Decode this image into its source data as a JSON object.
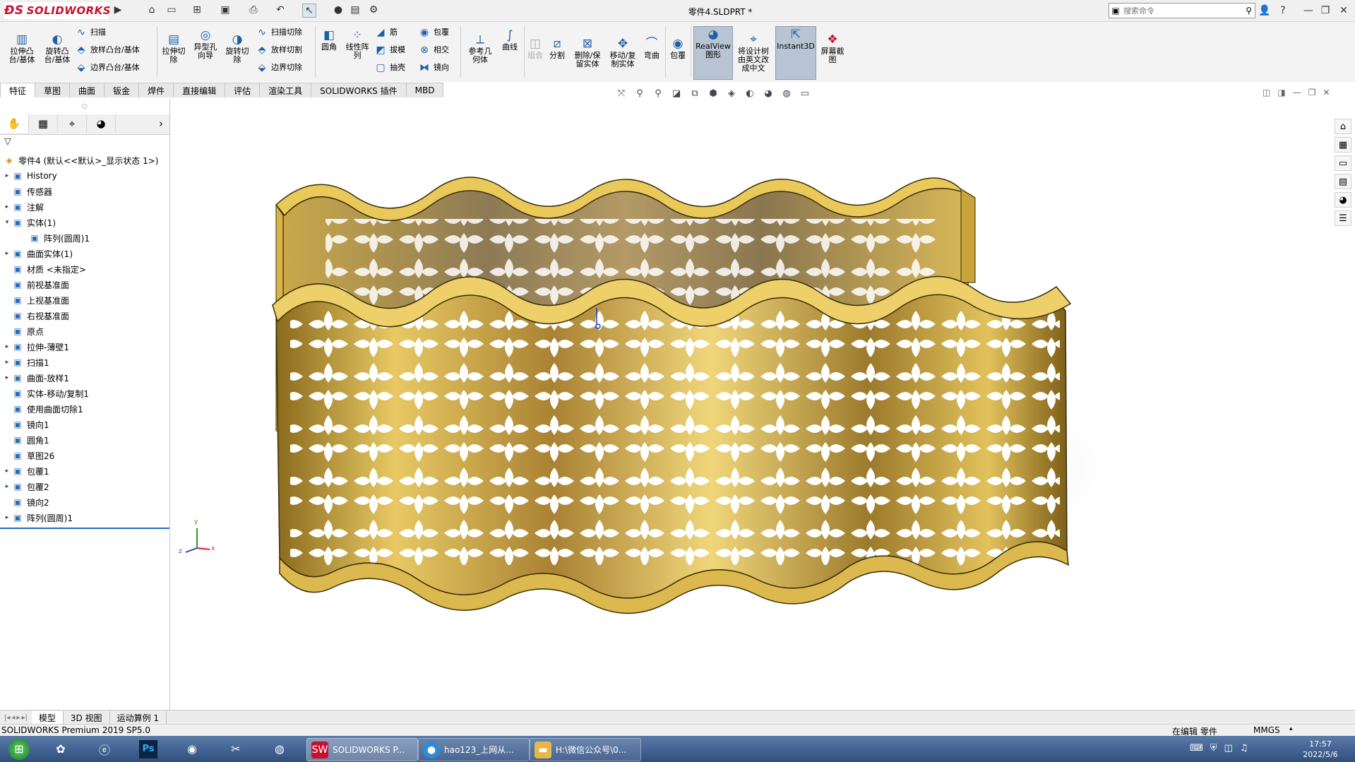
{
  "titlebar": {
    "logo": "SOLIDWORKS",
    "document_title": "零件4.SLDPRT *",
    "search_placeholder": "搜索命令",
    "help": "?"
  },
  "ribbon": {
    "tools_large": [
      {
        "label": "拉伸凸\n台/基体",
        "icon": "extrude-boss-icon"
      },
      {
        "label": "旋转凸\n台/基体",
        "icon": "revolve-boss-icon"
      },
      {
        "label": "拉伸切\n除",
        "icon": "extrude-cut-icon"
      },
      {
        "label": "异型孔\n向导",
        "icon": "hole-wizard-icon"
      },
      {
        "label": "旋转切\n除",
        "icon": "revolve-cut-icon"
      },
      {
        "label": "圆角",
        "icon": "fillet-icon"
      },
      {
        "label": "线性阵\n列",
        "icon": "linear-pattern-icon"
      },
      {
        "label": "参考几\n何体",
        "icon": "reference-geometry-icon"
      },
      {
        "label": "曲线",
        "icon": "curves-icon"
      },
      {
        "label": "组合",
        "icon": "combine-icon"
      },
      {
        "label": "分割",
        "icon": "split-icon"
      },
      {
        "label": "删除/保\n留实体",
        "icon": "delete-body-icon"
      },
      {
        "label": "移动/复\n制实体",
        "icon": "move-copy-icon"
      },
      {
        "label": "弯曲",
        "icon": "flex-icon"
      },
      {
        "label": "包覆",
        "icon": "wrap-icon"
      },
      {
        "label": "RealView\n图形",
        "icon": "realview-icon"
      },
      {
        "label": "将设计树\n由英文改\n成中文",
        "icon": "translate-tree-icon"
      },
      {
        "label": "Instant3D",
        "icon": "instant3d-icon"
      },
      {
        "label": "屏幕截\n图",
        "icon": "screenshot-icon"
      }
    ],
    "tools_small": [
      {
        "label": "扫描",
        "icon": "sweep-icon"
      },
      {
        "label": "放样凸台/基体",
        "icon": "loft-icon"
      },
      {
        "label": "边界凸台/基体",
        "icon": "boundary-boss-icon"
      },
      {
        "label": "扫描切除",
        "icon": "swept-cut-icon"
      },
      {
        "label": "放样切割",
        "icon": "lofted-cut-icon"
      },
      {
        "label": "边界切除",
        "icon": "boundary-cut-icon"
      },
      {
        "label": "筋",
        "icon": "rib-icon"
      },
      {
        "label": "拔模",
        "icon": "draft-icon"
      },
      {
        "label": "抽壳",
        "icon": "shell-icon"
      },
      {
        "label": "包覆",
        "icon": "wrap-icon"
      },
      {
        "label": "相交",
        "icon": "intersect-icon"
      },
      {
        "label": "镜向",
        "icon": "mirror-icon"
      }
    ]
  },
  "tabs": [
    "特征",
    "草图",
    "曲面",
    "钣金",
    "焊件",
    "直接编辑",
    "评估",
    "渲染工具",
    "SOLIDWORKS 插件",
    "MBD"
  ],
  "tree": {
    "root": "零件4  (默认<<默认>_显示状态 1>)",
    "items": [
      {
        "label": "History",
        "icon": "history-icon",
        "expand": "▸"
      },
      {
        "label": "传感器",
        "icon": "sensor-icon",
        "expand": ""
      },
      {
        "label": "注解",
        "icon": "annotation-icon",
        "expand": "▸"
      },
      {
        "label": "实体(1)",
        "icon": "solid-bodies-icon",
        "expand": "▾"
      },
      {
        "label": "阵列(圆周)1",
        "icon": "body-icon",
        "expand": "",
        "indent": true
      },
      {
        "label": "曲面实体(1)",
        "icon": "surface-bodies-icon",
        "expand": "▸"
      },
      {
        "label": "材质 <未指定>",
        "icon": "material-icon",
        "expand": ""
      },
      {
        "label": "前视基准面",
        "icon": "plane-icon",
        "expand": ""
      },
      {
        "label": "上视基准面",
        "icon": "plane-icon",
        "expand": ""
      },
      {
        "label": "右视基准面",
        "icon": "plane-icon",
        "expand": ""
      },
      {
        "label": "原点",
        "icon": "origin-icon",
        "expand": ""
      },
      {
        "label": "拉伸-薄壁1",
        "icon": "extrude-icon",
        "expand": "▸"
      },
      {
        "label": "扫描1",
        "icon": "sweep-icon",
        "expand": "▸"
      },
      {
        "label": "曲面-放样1",
        "icon": "surface-loft-icon",
        "expand": "▸"
      },
      {
        "label": "实体-移动/复制1",
        "icon": "move-copy-icon",
        "expand": ""
      },
      {
        "label": "使用曲面切除1",
        "icon": "surface-cut-icon",
        "expand": ""
      },
      {
        "label": "镜向1",
        "icon": "mirror-icon",
        "expand": ""
      },
      {
        "label": "圆角1",
        "icon": "fillet-icon",
        "expand": ""
      },
      {
        "label": "草图26",
        "icon": "sketch-icon",
        "expand": ""
      },
      {
        "label": "包覆1",
        "icon": "wrap-icon",
        "expand": "▸"
      },
      {
        "label": "包覆2",
        "icon": "wrap-icon",
        "expand": "▸"
      },
      {
        "label": "镜向2",
        "icon": "mirror-icon",
        "expand": ""
      },
      {
        "label": "阵列(圆周)1",
        "icon": "circular-pattern-icon",
        "expand": "▸"
      }
    ]
  },
  "triad": {
    "x": "x",
    "y": "y",
    "z": "z"
  },
  "model_tabs": [
    "模型",
    "3D 视图",
    "运动算例 1"
  ],
  "status": {
    "app": "SOLIDWORKS Premium 2019 SP5.0",
    "mode": "在编辑 零件",
    "units": "MMGS"
  },
  "taskbar": {
    "buttons": [
      {
        "label": "SOLIDWORKS P...",
        "icon": "solidworks-app-icon",
        "color": "#c8102e"
      },
      {
        "label": "hao123_上网从...",
        "icon": "browser-app-icon",
        "color": "#2e8bd8"
      },
      {
        "label": "H:\\微信公众号\\0...",
        "icon": "folder-app-icon",
        "color": "#e6b84a"
      }
    ],
    "time": "17:57",
    "date": "2022/5/6"
  },
  "colors": {
    "gold": "#c9a43a",
    "accent": "#1f5fa8"
  }
}
